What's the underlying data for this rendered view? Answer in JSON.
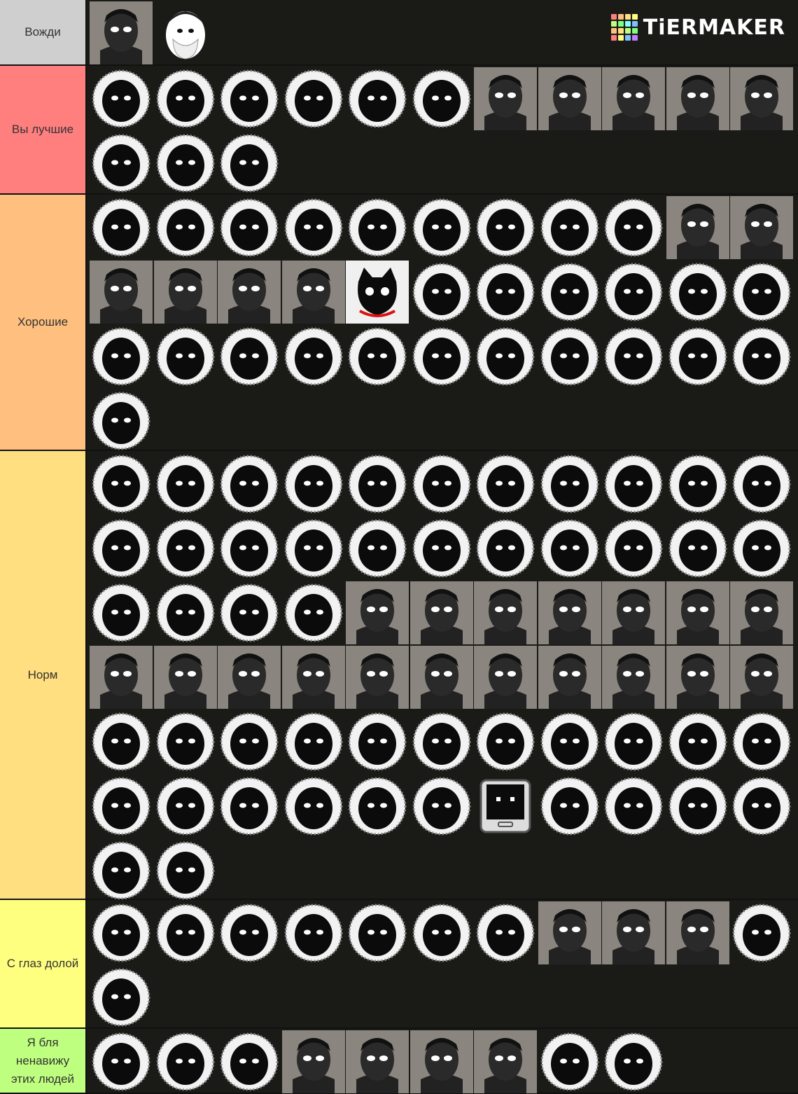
{
  "brand": {
    "name": "TiERMAKER",
    "grid_colors": [
      "#ff7f7f",
      "#ffbf7f",
      "#ffdf7f",
      "#ffff7f",
      "#bfff7f",
      "#7fff7f",
      "#7fffff",
      "#7fbfff",
      "#ffbf7f",
      "#ffdf7f",
      "#bfff7f",
      "#7fff7f",
      "#ff7f7f",
      "#ffff7f",
      "#7fbfff",
      "#bf7fff"
    ]
  },
  "tiers": [
    {
      "label": "Вожди",
      "color": "#cfcfcf",
      "items": [
        "photo",
        "white"
      ]
    },
    {
      "label": "Вы лучшие",
      "color": "#ff7f7f",
      "items": [
        "sil",
        "sil",
        "sil",
        "sil",
        "sil",
        "sil",
        "photo",
        "photo",
        "photo",
        "photo",
        "photo",
        "sil",
        "sil",
        "sil"
      ]
    },
    {
      "label": "Хорошие",
      "color": "#ffbf7f",
      "items": [
        "sil",
        "sil",
        "sil",
        "sil",
        "sil",
        "sil",
        "sil",
        "sil",
        "sil",
        "photo",
        "photo",
        "photo",
        "photo",
        "photo",
        "photo",
        "cat",
        "sil",
        "sil",
        "sil",
        "sil",
        "sil",
        "sil",
        "sil",
        "sil",
        "sil",
        "sil",
        "sil",
        "sil",
        "sil",
        "sil",
        "sil",
        "sil",
        "sil",
        "sil"
      ]
    },
    {
      "label": "Норм",
      "color": "#ffdf7f",
      "items": [
        "sil",
        "sil",
        "sil",
        "sil",
        "sil",
        "sil",
        "sil",
        "sil",
        "sil",
        "sil",
        "sil",
        "sil",
        "sil",
        "sil",
        "sil",
        "sil",
        "sil",
        "sil",
        "sil",
        "sil",
        "sil",
        "sil",
        "sil",
        "sil",
        "sil",
        "sil",
        "photo",
        "photo",
        "photo",
        "photo",
        "photo",
        "photo",
        "photo",
        "photo",
        "photo",
        "photo",
        "photo",
        "photo",
        "photo",
        "photo",
        "photo",
        "photo",
        "photo",
        "photo",
        "sil",
        "sil",
        "sil",
        "sil",
        "sil",
        "sil",
        "sil",
        "sil",
        "sil",
        "sil",
        "sil",
        "sil",
        "sil",
        "sil",
        "sil",
        "sil",
        "sil",
        "tablet",
        "sil",
        "sil",
        "sil",
        "sil",
        "sil",
        "sil"
      ]
    },
    {
      "label": "С глаз долой",
      "color": "#ffff7f",
      "items": [
        "sil",
        "sil",
        "sil",
        "sil",
        "sil",
        "sil",
        "sil",
        "photo",
        "photo",
        "photo",
        "sil",
        "sil"
      ]
    },
    {
      "label": "Я бля ненавижу этих людей",
      "color": "#bfff7f",
      "items": [
        "sil",
        "sil",
        "sil",
        "photo",
        "photo",
        "photo",
        "photo",
        "sil",
        "sil"
      ]
    }
  ]
}
